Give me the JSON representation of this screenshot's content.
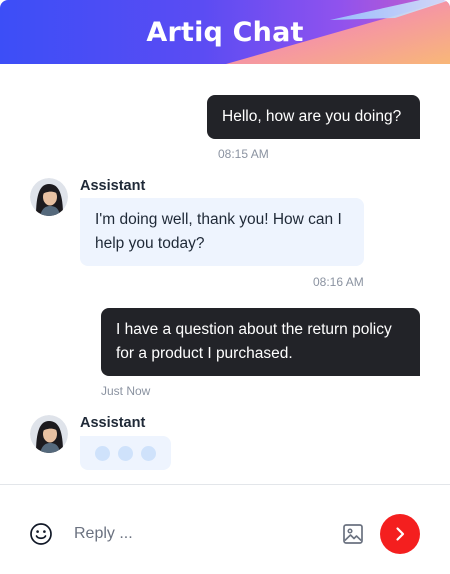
{
  "app": {
    "title": "Artiq Chat"
  },
  "colors": {
    "header_gradient": [
      "#3b4df6",
      "#8a52f0",
      "#f37db0",
      "#f6b277"
    ],
    "outgoing_bubble": "#222328",
    "incoming_bubble": "#eef4fe",
    "send_button": "#f41f1f"
  },
  "messages": [
    {
      "direction": "outgoing",
      "text": "Hello, how are you doing?",
      "time": "08:15 AM"
    },
    {
      "direction": "incoming",
      "sender": "Assistant",
      "avatar": "avatar-icon",
      "text": "I'm doing well, thank you! How can I help you today?",
      "time": "08:16 AM"
    },
    {
      "direction": "outgoing",
      "text": "I have a question about the return policy for a product I purchased.",
      "time": "Just Now"
    },
    {
      "direction": "incoming",
      "sender": "Assistant",
      "avatar": "avatar-icon",
      "typing": true
    }
  ],
  "composer": {
    "placeholder": "Reply ...",
    "value": "",
    "emoji_icon": "smiley-icon",
    "image_icon": "image-icon",
    "send_icon": "chevron-right-icon"
  }
}
